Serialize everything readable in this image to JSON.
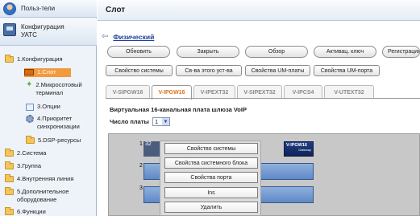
{
  "sidebar": {
    "users_label": "Польз-тели",
    "config_label_line1": "Конфигурация",
    "config_label_line2": "УАТС",
    "tree": [
      {
        "label1": "1.Конфигурация",
        "label2": ""
      },
      {
        "label1": "1.Слот",
        "label2": ""
      },
      {
        "label1": "2.Микросотовый",
        "label2": "терминал"
      },
      {
        "label1": "3.Опции",
        "label2": ""
      },
      {
        "label1": "4.Приоритет",
        "label2": "синхронизации"
      },
      {
        "label1": "5.DSP-ресурсы",
        "label2": ""
      },
      {
        "label1": "2.Система",
        "label2": ""
      },
      {
        "label1": "3.Группа",
        "label2": ""
      },
      {
        "label1": "4.Внутренняя линия",
        "label2": ""
      },
      {
        "label1": "5.Дополнительное",
        "label2": "оборудование"
      },
      {
        "label1": "6.Функции",
        "label2": ""
      }
    ]
  },
  "header": {
    "title": "Слот"
  },
  "breadcrumb": {
    "link": "Физический"
  },
  "toolbar1": [
    "Обновить",
    "Закрыть",
    "Обзор",
    "Активац. ключ",
    "Регистрация"
  ],
  "toolbar2": [
    "Свойство системы",
    "Св-ва этого уст-ва",
    "Свойства UM-платы",
    "Свойства UM-порта"
  ],
  "tabs": [
    "V-SIPGW16",
    "V-IPGW16",
    "V-IPEXT32",
    "V-SIPEXT32",
    "V-IPCS4",
    "V-UTEXT32"
  ],
  "active_tab": 1,
  "card": {
    "title": "Виртуальная 16-канальная плата шлюза VoIP",
    "count_label": "Число платы",
    "count_value": "1"
  },
  "rack": {
    "slots": [
      "1",
      "2",
      "3"
    ],
    "slot1_value": "32",
    "module_label": "V-IPGW16",
    "module_sublabel": "Gateway"
  },
  "context_menu": [
    "Свойство системы",
    "Свойства системного блока",
    "Свойства порта",
    "Ins",
    "Удалить"
  ]
}
